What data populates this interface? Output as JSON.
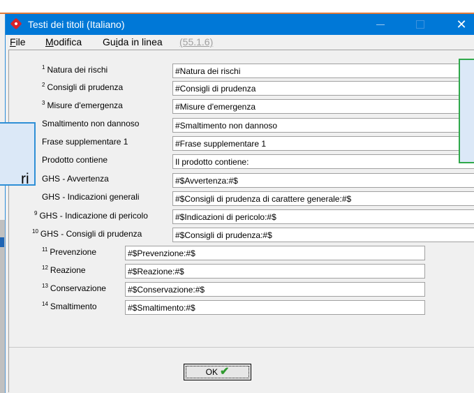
{
  "window": {
    "title": "Testi dei titoli (Italiano)",
    "close_glyph": "✕"
  },
  "menu": {
    "file_mnemonic": "F",
    "file_rest": "ile",
    "modifica_mnemonic": "M",
    "modifica_rest": "odifica",
    "guida_pre": "Gu",
    "guida_mnemonic": "i",
    "guida_rest": "da in linea",
    "version": "(55.1.6)"
  },
  "rows": [
    {
      "num": "1",
      "label": "Natura dei rischi",
      "value": "#Natura dei rischi"
    },
    {
      "num": "2",
      "label": "Consigli di prudenza",
      "value": "#Consigli di prudenza"
    },
    {
      "num": "3",
      "label": "Misure d'emergenza",
      "value": "#Misure d'emergenza"
    },
    {
      "num": "",
      "label": "Smaltimento non dannoso",
      "value": "#Smaltimento non dannoso"
    },
    {
      "num": "",
      "label": "Frase supplementare 1",
      "value": "#Frase supplementare 1"
    },
    {
      "num": "",
      "label": "Prodotto contiene",
      "value": "Il prodotto contiene:"
    },
    {
      "num": "",
      "label": "GHS - Avvertenza",
      "value": "#$Avvertenza:#$"
    },
    {
      "num": "",
      "label": "GHS - Indicazioni generali",
      "value": "#$Consigli di prudenza di carattere generale:#$"
    },
    {
      "num": "9",
      "label": "GHS - Indicazione di pericolo",
      "value": "#$Indicazioni di pericolo:#$"
    },
    {
      "num": "10",
      "label": "GHS - Consigli di prudenza",
      "value": "#$Consigli di prudenza:#$"
    }
  ],
  "subrows": [
    {
      "num": "11",
      "label": "Prevenzione",
      "value": "#$Prevenzione:#$"
    },
    {
      "num": "12",
      "label": "Reazione",
      "value": "#$Reazione:#$"
    },
    {
      "num": "13",
      "label": "Conservazione",
      "value": "#$Conservazione:#$"
    },
    {
      "num": "14",
      "label": "Smaltimento",
      "value": "#$Smaltimento:#$"
    }
  ],
  "ok_button": {
    "label": "OK",
    "check": "✔"
  },
  "overlay": {
    "callout_text": "ri"
  },
  "colors": {
    "titlebar": "#0078d7",
    "accent_orange": "#e07a3a",
    "check_green": "#2f9a2f"
  }
}
